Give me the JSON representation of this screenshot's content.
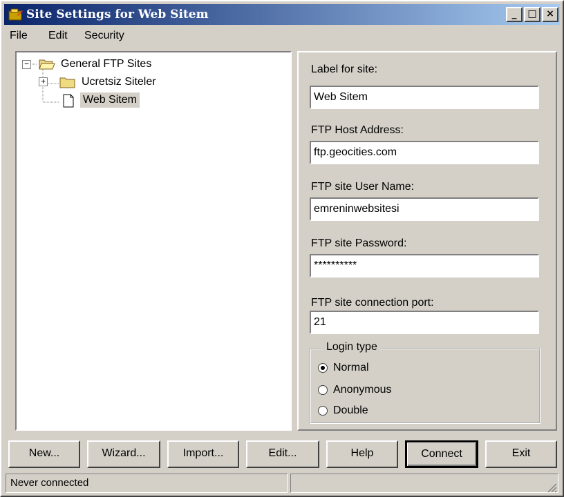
{
  "window": {
    "title": "Site Settings for Web Sitem",
    "minimize_glyph": "_",
    "maximize_glyph": "□",
    "close_glyph": "×"
  },
  "menu": {
    "items": [
      "File",
      "Edit",
      "Security"
    ]
  },
  "tree": {
    "root": {
      "label": "General FTP Sites",
      "expander": "−",
      "icon": "open-folder-icon"
    },
    "children": [
      {
        "label": "Ucretsiz Siteler",
        "expander": "+",
        "icon": "folder-icon"
      },
      {
        "label": "Web Sitem",
        "icon": "document-icon",
        "selected": true
      }
    ]
  },
  "form": {
    "label_site": {
      "label": "Label for site:",
      "value": "Web Sitem"
    },
    "host": {
      "label": "FTP Host Address:",
      "value": "ftp.geocities.com"
    },
    "user": {
      "label": "FTP site User Name:",
      "value": "emreninwebsitesi"
    },
    "password": {
      "label": "FTP site Password:",
      "value": "**********"
    },
    "port": {
      "label": "FTP site connection port:",
      "value": "21"
    },
    "login_type": {
      "title": "Login type",
      "options": [
        "Normal",
        "Anonymous",
        "Double"
      ],
      "selected": "Normal"
    }
  },
  "buttons": {
    "new": "New...",
    "wizard": "Wizard...",
    "import": "Import...",
    "edit": "Edit...",
    "help": "Help",
    "connect": "Connect",
    "exit": "Exit"
  },
  "status": {
    "text": "Never connected"
  },
  "colors": {
    "titlebar_start": "#0a246a",
    "titlebar_end": "#a6caf0",
    "face": "#d4d0c8",
    "selection": "#d4d0c8"
  }
}
